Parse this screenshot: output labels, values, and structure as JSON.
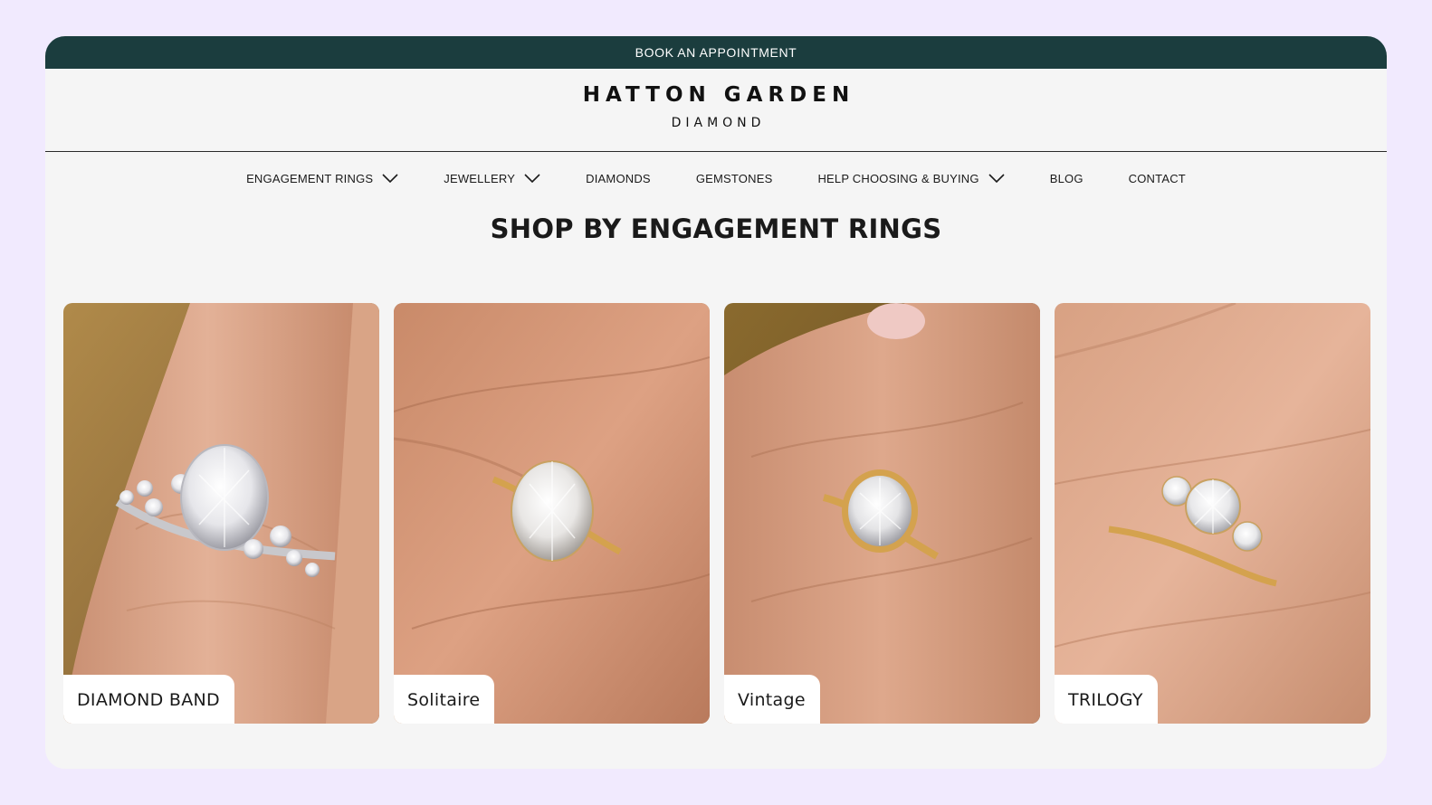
{
  "topbar": {
    "label": "BOOK AN APPOINTMENT"
  },
  "logo": {
    "main": "HATTON GARDEN",
    "sub": "DIAMOND"
  },
  "nav": {
    "items": [
      {
        "label": "ENGAGEMENT RINGS",
        "has_dropdown": true
      },
      {
        "label": "JEWELLERY",
        "has_dropdown": true
      },
      {
        "label": "DIAMONDS",
        "has_dropdown": false
      },
      {
        "label": "GEMSTONES",
        "has_dropdown": false
      },
      {
        "label": "HELP CHOOSING & BUYING",
        "has_dropdown": true
      },
      {
        "label": "BLOG",
        "has_dropdown": false
      },
      {
        "label": "CONTACT",
        "has_dropdown": false
      }
    ]
  },
  "section": {
    "title": "SHOP BY ENGAGEMENT RINGS"
  },
  "cards": [
    {
      "label": "DIAMOND BAND",
      "metal": "white gold"
    },
    {
      "label": "Solitaire",
      "metal": "yellow gold"
    },
    {
      "label": "Vintage",
      "metal": "yellow gold"
    },
    {
      "label": "TRILOGY",
      "metal": "yellow gold"
    }
  ],
  "colors": {
    "page_bg": "#f1eafe",
    "topbar_bg": "#1b3d3e",
    "content_bg": "#f5f5f5",
    "skin": "#d9a486",
    "gold": "#d4a24e",
    "silver": "#d8d8dc"
  }
}
